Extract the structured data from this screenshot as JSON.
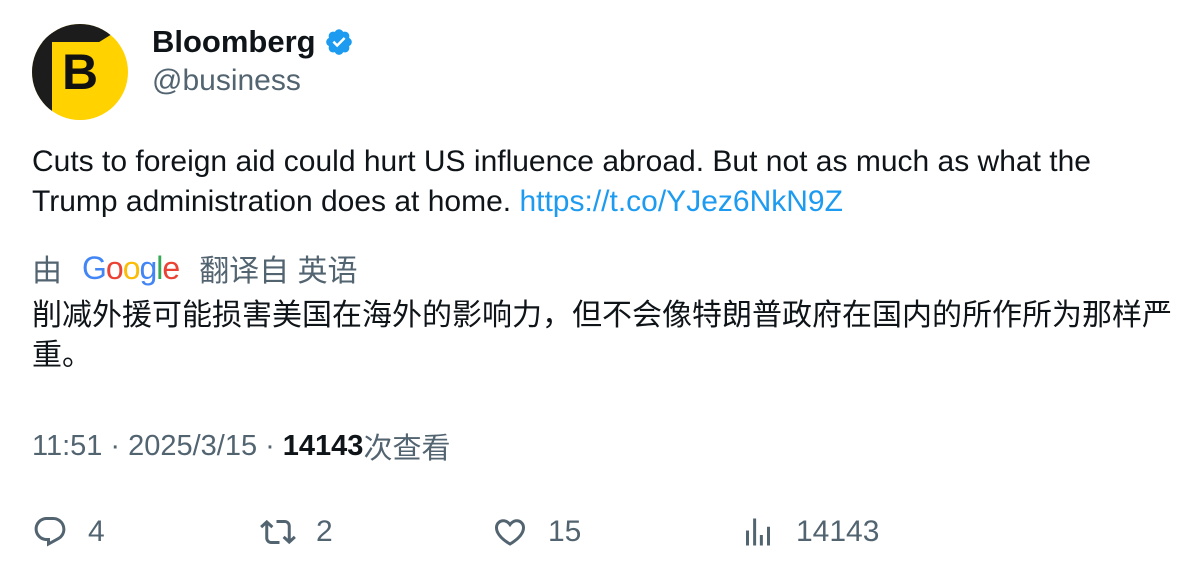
{
  "author": {
    "avatar_letter": "B",
    "display_name": "Bloomberg",
    "handle": "@business",
    "verified": true
  },
  "tweet": {
    "text": "Cuts to foreign aid could hurt US influence abroad. But not as much as what the Trump administration does at home.",
    "link": "https://t.co/YJez6NkN9Z"
  },
  "translation": {
    "prefix": "由",
    "provider": "Google",
    "suffix": "翻译自 英语",
    "text": "削减外援可能损害美国在海外的影响力，但不会像特朗普政府在国内的所作所为那样严重。"
  },
  "meta": {
    "time": "11:51",
    "separator": "·",
    "date": "2025/3/15",
    "views": "14143",
    "views_label": "次查看"
  },
  "actions": {
    "replies": "4",
    "retweets": "2",
    "likes": "15",
    "views": "14143"
  },
  "colors": {
    "link": "#1d9bf0",
    "secondary_text": "#536471",
    "verified_badge": "#1d9bf0",
    "avatar_bg": "#ffd200"
  },
  "icons": [
    "verified-badge-icon",
    "reply-icon",
    "retweet-icon",
    "like-icon",
    "views-icon"
  ]
}
